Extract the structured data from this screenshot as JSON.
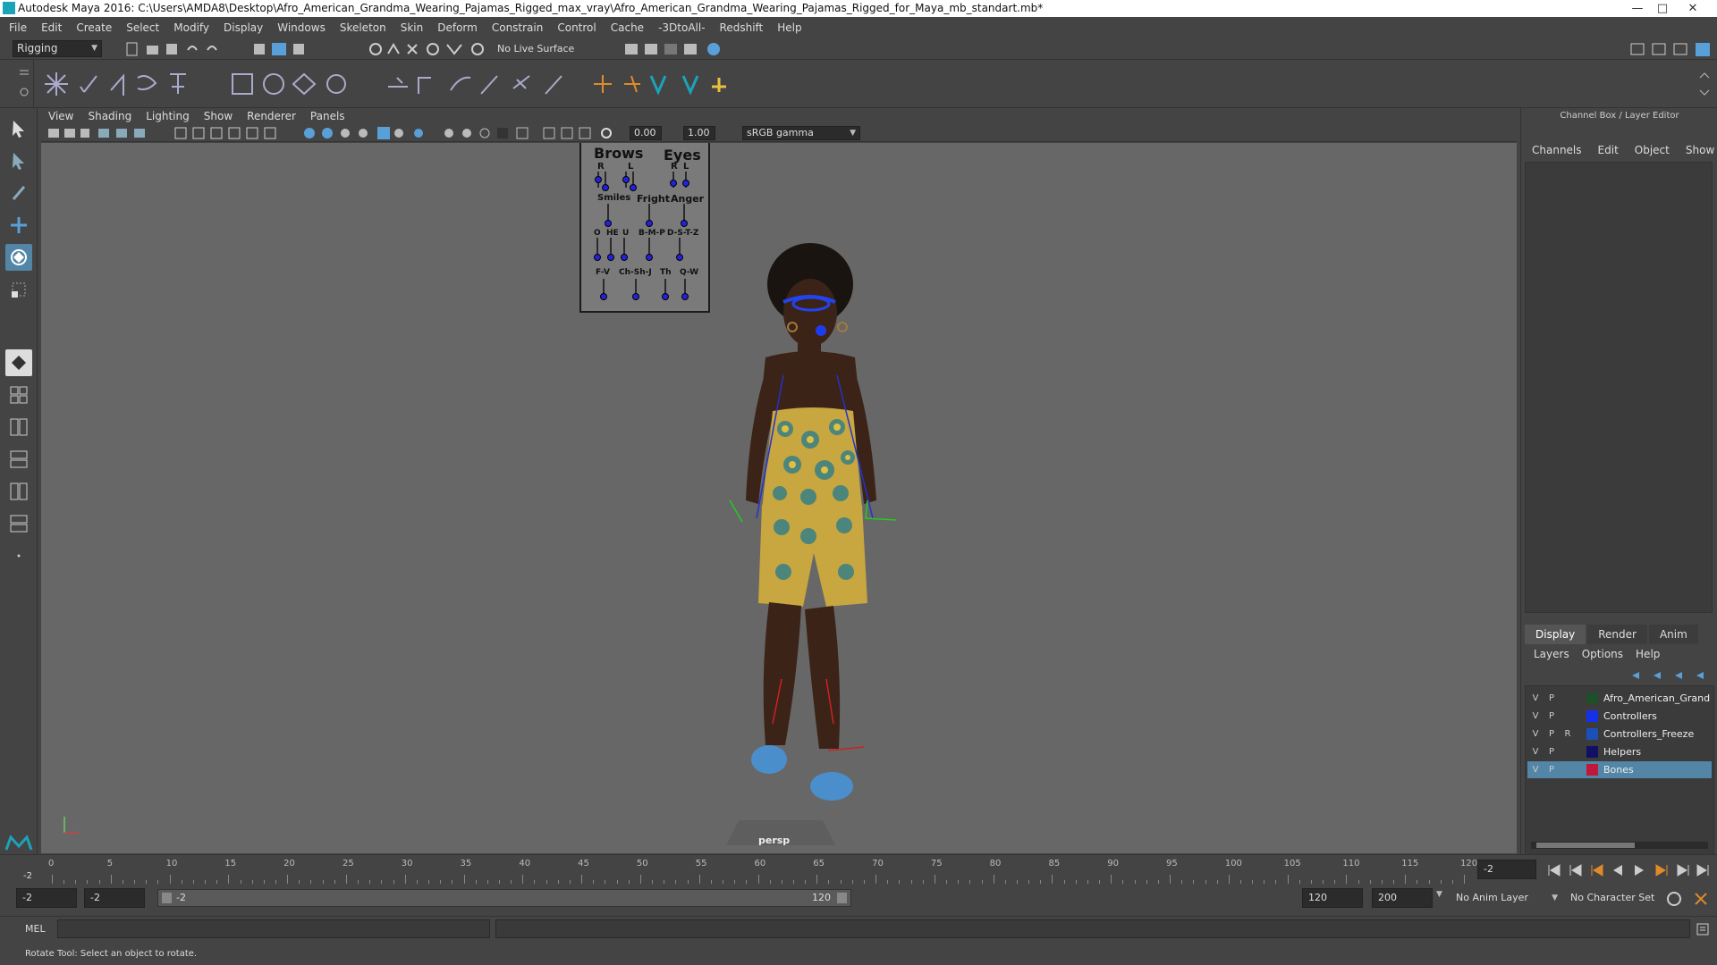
{
  "window": {
    "title": "Autodesk Maya 2016: C:\\Users\\AMDA8\\Desktop\\Afro_American_Grandma_Wearing_Pajamas_Rigged_max_vray\\Afro_American_Grandma_Wearing_Pajamas_Rigged_for_Maya_mb_standart.mb*"
  },
  "menubar": [
    "File",
    "Edit",
    "Create",
    "Select",
    "Modify",
    "Display",
    "Windows",
    "Skeleton",
    "Skin",
    "Deform",
    "Constrain",
    "Control",
    "Cache",
    "-3DtoAll-",
    "Redshift",
    "Help"
  ],
  "statusline": {
    "mode": "Rigging",
    "live_surface": "No Live Surface"
  },
  "panel": {
    "menu": [
      "View",
      "Shading",
      "Lighting",
      "Show",
      "Renderer",
      "Panels"
    ],
    "exposure": "0.00",
    "gamma": "1.00",
    "colorspace": "sRGB gamma",
    "camera": "persp"
  },
  "facial_controls": {
    "brows": "Brows",
    "eyes": "Eyes",
    "r1": "R",
    "l1": "L",
    "r2": "R",
    "l2": "L",
    "smiles": "Smiles",
    "fright": "Fright",
    "anger": "Anger",
    "o": "O",
    "he": "HE",
    "u": "U",
    "bmp": "B-M-P",
    "dstz": "D-S-T-Z",
    "fv": "F-V",
    "chshj": "Ch-Sh-J",
    "th": "Th",
    "qw": "Q-W"
  },
  "channel_box": {
    "title": "Channel Box / Layer Editor",
    "menu": [
      "Channels",
      "Edit",
      "Object",
      "Show"
    ],
    "tabs": [
      "Display",
      "Render",
      "Anim"
    ],
    "active_tab": "Display",
    "layer_menu": [
      "Layers",
      "Options",
      "Help"
    ],
    "layers": [
      {
        "v": "V",
        "p": "P",
        "r": "",
        "name": "Afro_American_Grandma",
        "color": "#1e4e2a"
      },
      {
        "v": "V",
        "p": "P",
        "r": "",
        "name": "Controllers",
        "color": "#1530e6"
      },
      {
        "v": "V",
        "p": "P",
        "r": "R",
        "name": "Controllers_Freeze",
        "color": "#1c4fb8"
      },
      {
        "v": "V",
        "p": "P",
        "r": "",
        "name": "Helpers",
        "color": "#101066"
      },
      {
        "v": "V",
        "p": "P",
        "r": "",
        "name": "Bones",
        "color": "#c0183b",
        "selected": true
      }
    ]
  },
  "timeline": {
    "current_frame": "-2",
    "start_marker": "-2",
    "ticks": [
      "0",
      "5",
      "10",
      "15",
      "20",
      "25",
      "30",
      "35",
      "40",
      "45",
      "50",
      "55",
      "60",
      "65",
      "70",
      "75",
      "80",
      "85",
      "90",
      "95",
      "100",
      "105",
      "110",
      "115",
      "120"
    ],
    "frame_field": "-2"
  },
  "range": {
    "start": "-2",
    "playback_start": "-2",
    "slider_start": "-2",
    "slider_end": "120",
    "playback_end": "120",
    "end": "200",
    "anim_layer": "No Anim Layer",
    "character_set": "No Character Set"
  },
  "cmdline": {
    "label": "MEL"
  },
  "helpline": {
    "text": "Rotate Tool: Select an object to rotate."
  }
}
